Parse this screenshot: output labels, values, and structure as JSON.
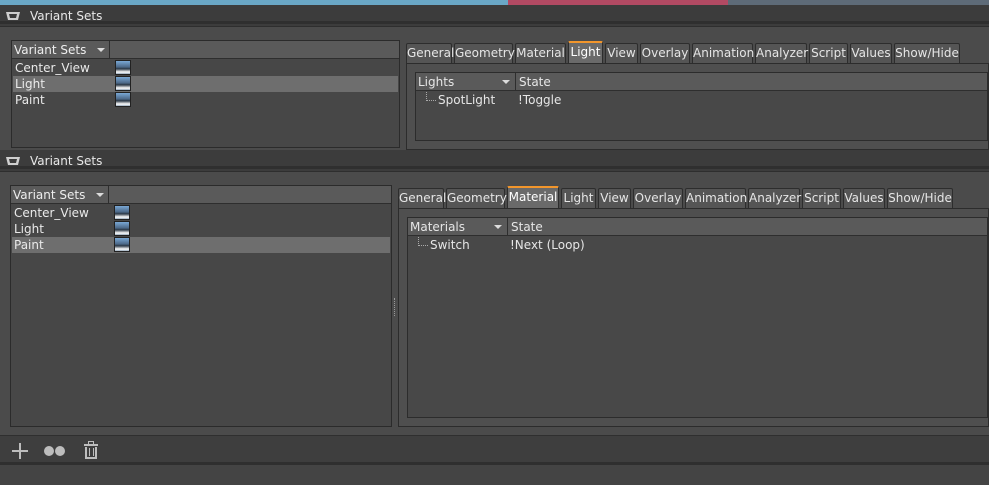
{
  "windows": [
    {
      "title": "Variant Sets",
      "list": {
        "header": "Variant Sets",
        "items": [
          "Center_View",
          "Light",
          "Paint"
        ],
        "selected_index": 1
      },
      "tabs": [
        "General",
        "Geometry",
        "Material",
        "Light",
        "View",
        "Overlay",
        "Animation",
        "Analyzer",
        "Script",
        "Values",
        "Show/Hide"
      ],
      "active_tab": "Light",
      "tree": {
        "col1_header": "Lights",
        "col2_header": "State",
        "rows": [
          {
            "name": "SpotLight",
            "state": "!Toggle"
          }
        ]
      }
    },
    {
      "title": "Variant Sets",
      "list": {
        "header": "Variant Sets",
        "items": [
          "Center_View",
          "Light",
          "Paint"
        ],
        "selected_index": 2
      },
      "tabs": [
        "General",
        "Geometry",
        "Material",
        "Light",
        "View",
        "Overlay",
        "Animation",
        "Analyzer",
        "Script",
        "Values",
        "Show/Hide"
      ],
      "active_tab": "Material",
      "tree": {
        "col1_header": "Materials",
        "col2_header": "State",
        "rows": [
          {
            "name": "Switch",
            "state": "!Next (Loop)"
          }
        ]
      }
    }
  ],
  "footer": {
    "icons": [
      "add-icon",
      "duplicate-icon",
      "trash-icon"
    ]
  },
  "colors": {
    "active_tab_accent": "#f2962c",
    "selection": "#6e6e6e",
    "background": "#4a4a4a"
  }
}
